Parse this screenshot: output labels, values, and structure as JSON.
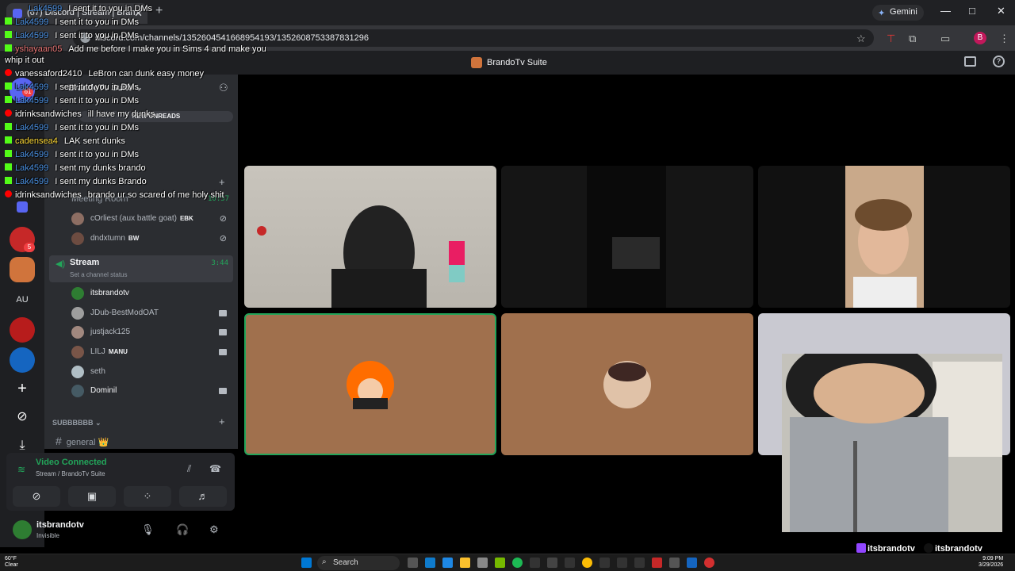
{
  "browser": {
    "tab_title": "(67) Discord | Stream | Bran",
    "tab_close": "✕",
    "new_tab": "+",
    "url": "discord.com/channels/1352604541668954193/1352608753387831296",
    "gemini_label": "Gemini",
    "profile_initial": "B",
    "window_min": "—",
    "window_max": "□",
    "window_close": "✕"
  },
  "discord": {
    "window_title": "BrandoTv Suite",
    "server_name": "BrandoTv Suite",
    "new_unreads": "NEW UNREADS",
    "rail": {
      "au_label": "AU",
      "badge_61": "61",
      "badge_5": "5",
      "add_icon": "+",
      "explore_icon": "⊘",
      "download_icon": "⤓"
    },
    "meeting_room": {
      "name": "Meeting Room",
      "time": "10:57",
      "members": [
        {
          "name": "cOrliest (aux battle goat)",
          "tag": "EBK"
        },
        {
          "name": "dndxtumn",
          "tag": "BW"
        }
      ]
    },
    "stream_channel": {
      "name": "Stream",
      "status": "Set a channel status",
      "time": "3:44",
      "members": [
        {
          "name": "itsbrandotv",
          "tag": ""
        },
        {
          "name": "JDub-BestModOAT",
          "tag": ""
        },
        {
          "name": "justjack125",
          "tag": ""
        },
        {
          "name": "LILJ",
          "tag": "MANU"
        },
        {
          "name": "seth",
          "tag": ""
        },
        {
          "name": "Dominil",
          "tag": ""
        }
      ]
    },
    "category": "SUBBBBBB",
    "general_channel": "general",
    "general_emoji": "👑",
    "voice_panel": {
      "status": "Video Connected",
      "location": "Stream / BrandoTv Suite"
    },
    "user": {
      "name": "itsbrandotv",
      "status": "Invisible"
    }
  },
  "chat_overlay": [
    {
      "platform": "kick",
      "user": "Lak4599",
      "msg": "I sent it to you in DMs"
    },
    {
      "platform": "kick",
      "user": "Lak4599",
      "msg": "I sent it to you in DMs"
    },
    {
      "platform": "kick",
      "user": "Lak4599",
      "msg": "I sent it to you in DMs"
    },
    {
      "platform": "kick",
      "user": "yshayaan05",
      "msg": "Add me before I make you in Sims 4 and make you"
    },
    {
      "platform": "",
      "user": "",
      "msg": "whip it out"
    },
    {
      "platform": "youtube",
      "user": "vanessaford2410",
      "msg": "LeBron can dunk easy money"
    },
    {
      "platform": "kick",
      "user": "Lak4599",
      "msg": "I sent it to you in DMs"
    },
    {
      "platform": "kick",
      "user": "Lak4599",
      "msg": "I sent it to you in DMs"
    },
    {
      "platform": "youtube",
      "user": "idrinksandwiches",
      "msg": "ill have my dunks"
    },
    {
      "platform": "kick",
      "user": "Lak4599",
      "msg": "I sent it to you in DMs"
    },
    {
      "platform": "kick",
      "user": "cadensea4",
      "msg": "LAK sent dunks"
    },
    {
      "platform": "kick",
      "user": "Lak4599",
      "msg": "I sent it to you in DMs"
    },
    {
      "platform": "kick",
      "user": "Lak4599",
      "msg": "I sent my dunks brando"
    },
    {
      "platform": "kick",
      "user": "Lak4599",
      "msg": "I sent my dunks Brando"
    },
    {
      "platform": "youtube",
      "user": "idrinksandwiches",
      "msg": "brando ur so scared of me holy shit"
    }
  ],
  "stream_overlay": {
    "twitch_handle": "itsbrandotv",
    "tiktok_handle": "itsbrandotv"
  },
  "taskbar": {
    "weather_temp": "60°F",
    "weather_desc": "Clear",
    "search_label": "Search",
    "time": "9:09 PM",
    "date": "3/29/2026"
  },
  "colors": {
    "accent_green": "#23a55a",
    "discord_bg": "#2b2d31",
    "tile_brown": "#a0704d"
  }
}
